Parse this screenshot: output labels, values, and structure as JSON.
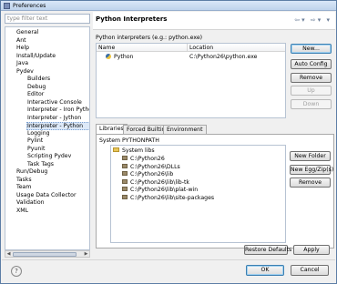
{
  "window": {
    "title": "Preferences"
  },
  "filter": {
    "placeholder": "type filter text"
  },
  "tree": {
    "items": [
      {
        "label": "General",
        "level": 1
      },
      {
        "label": "Ant",
        "level": 1
      },
      {
        "label": "Help",
        "level": 1
      },
      {
        "label": "Install/Update",
        "level": 1
      },
      {
        "label": "Java",
        "level": 1
      },
      {
        "label": "Pydev",
        "level": 1
      },
      {
        "label": "Builders",
        "level": 2
      },
      {
        "label": "Debug",
        "level": 2
      },
      {
        "label": "Editor",
        "level": 2
      },
      {
        "label": "Interactive Console",
        "level": 2
      },
      {
        "label": "Interpreter - Iron Pytho",
        "level": 2
      },
      {
        "label": "Interpreter - Jython",
        "level": 2
      },
      {
        "label": "Interpreter - Python",
        "level": 2,
        "selected": true
      },
      {
        "label": "Logging",
        "level": 2
      },
      {
        "label": "Pylint",
        "level": 2
      },
      {
        "label": "Pyunit",
        "level": 2
      },
      {
        "label": "Scripting Pydev",
        "level": 2
      },
      {
        "label": "Task Tags",
        "level": 2
      },
      {
        "label": "Run/Debug",
        "level": 1
      },
      {
        "label": "Tasks",
        "level": 1
      },
      {
        "label": "Team",
        "level": 1
      },
      {
        "label": "Usage Data Collector",
        "level": 1
      },
      {
        "label": "Validation",
        "level": 1
      },
      {
        "label": "XML",
        "level": 1
      }
    ]
  },
  "page": {
    "title": "Python Interpreters",
    "description": "Python interpreters (e.g.: python.exe)"
  },
  "interpreters": {
    "columns": [
      "Name",
      "Location"
    ],
    "rows": [
      {
        "name": "Python",
        "location": "C:\\Python26\\python.exe"
      }
    ]
  },
  "buttons": {
    "new": "New...",
    "auto_config": "Auto Config",
    "remove": "Remove",
    "up": "Up",
    "down": "Down",
    "new_folder": "New Folder",
    "new_egg_zip": "New Egg/Zip(s)",
    "remove_lib": "Remove",
    "restore_defaults": "Restore Defaults",
    "apply": "Apply",
    "ok": "OK",
    "cancel": "Cancel"
  },
  "tabs": [
    "Libraries",
    "Forced Builtins",
    "Environment"
  ],
  "libraries": {
    "section_label": "System PYTHONPATH",
    "root": "System libs",
    "paths": [
      "C:\\Python26",
      "C:\\Python26\\DLLs",
      "C:\\Python26\\lib",
      "C:\\Python26\\lib\\lib-tk",
      "C:\\Python26\\lib\\plat-win",
      "C:\\Python26\\lib\\site-packages"
    ]
  },
  "icons": {
    "window": "preferences-window-icon",
    "help": "help-icon",
    "back": "back-arrow-icon",
    "forward": "forward-arrow-icon",
    "menu": "view-menu-icon",
    "python": "python-icon",
    "folder": "folder-icon",
    "library": "library-icon"
  }
}
